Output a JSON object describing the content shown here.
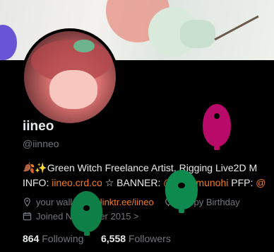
{
  "profile": {
    "display_name": "iineo",
    "handle": "@iinneo",
    "bio_line1_prefix": "🍂✨",
    "bio_line1": "Green Witch Freelance Artist, Rigging Live2D M",
    "bio_line2_prefix": "INFO: ",
    "bio_link1": "iineo.crd.co",
    "bio_line2_mid": " ☆ BANNER: ",
    "bio_banner_handle": "@_Kyomunohi",
    "bio_line2_pfp": " PFP: ",
    "bio_pfp_handle": "@"
  },
  "meta": {
    "location": "your walls",
    "website": "linktr.ee/iineo",
    "birthday": "Happy Birthday",
    "joined": "Joined November 2015",
    "chevron": ">"
  },
  "stats": {
    "following_count": "864",
    "following_label": "Following",
    "followers_count": "6,558",
    "followers_label": "Followers"
  },
  "colors": {
    "accent_link": "#f27a1a",
    "balloon_magenta": "#b80a68",
    "balloon_green": "#0f8a4e",
    "balloon_purple": "#6a54d6"
  },
  "icons": [
    "location-pin-icon",
    "link-icon",
    "balloon-icon",
    "calendar-icon",
    "chevron-right-icon"
  ]
}
